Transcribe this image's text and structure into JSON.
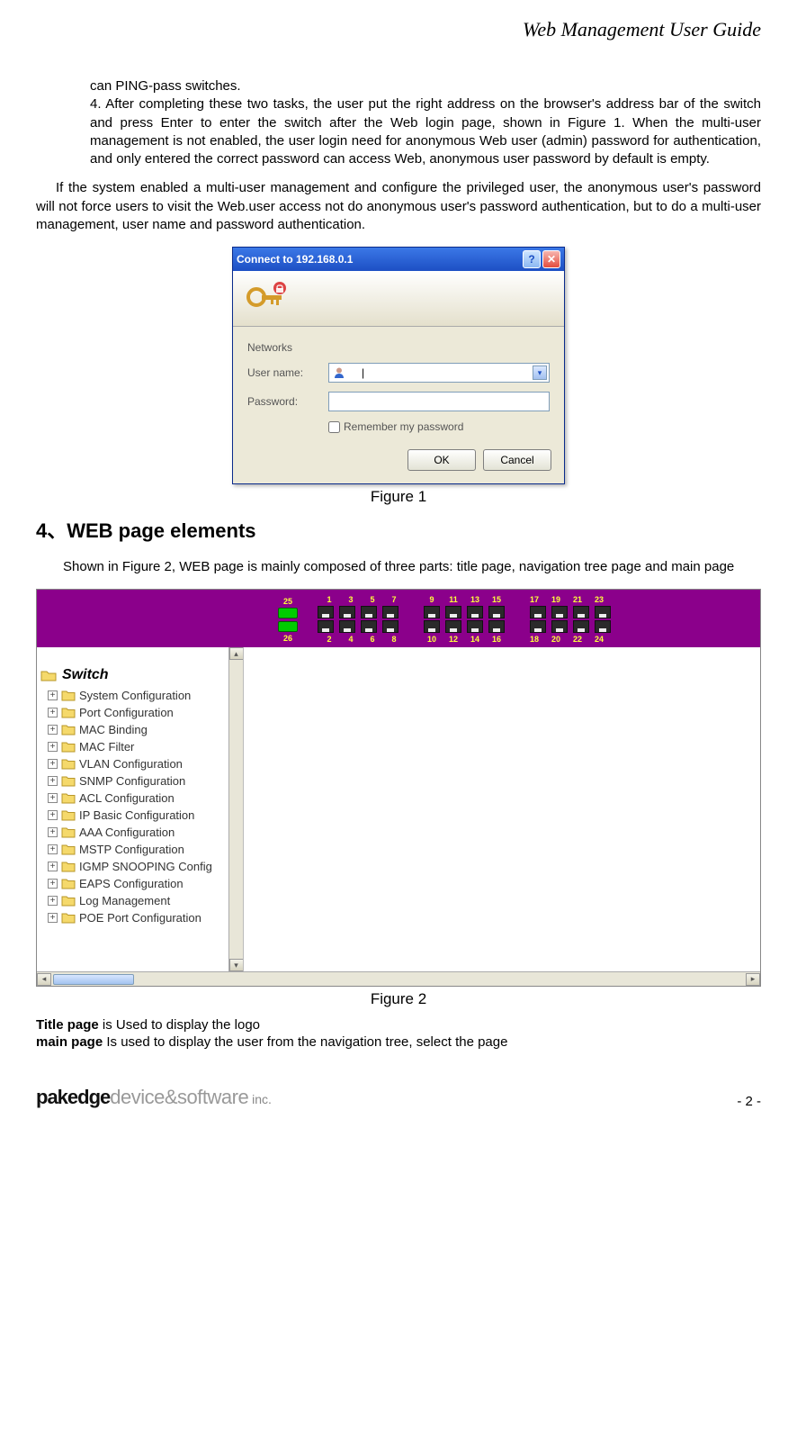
{
  "header": {
    "title": "Web Management User Guide"
  },
  "paragraphs": {
    "p1a": "can PING-pass switches.",
    "p1b": "4. After completing these two tasks, the user put the right address on the browser's address bar of the switch and press Enter to enter the switch after the Web login page, shown in Figure 1. When the multi-user management is not enabled, the user login need for anonymous Web user (admin) password for authentication, and only entered the correct password can access Web, anonymous user password by default is empty.",
    "p2": "If the system enabled a multi-user management and configure the privileged user, the anonymous user's password will not force users to visit the Web.user access not do anonymous user's password authentication, but to do a multi-user management, user name and password authentication."
  },
  "dialog": {
    "title": "Connect to 192.168.0.1",
    "network_label": "Networks",
    "username_label": "User name:",
    "username_value": "",
    "password_label": "Password:",
    "password_value": "",
    "remember": "Remember my password",
    "ok": "OK",
    "cancel": "Cancel"
  },
  "captions": {
    "fig1": "Figure 1",
    "fig2": "Figure 2"
  },
  "section_heading": "4、WEB page elements",
  "section_intro": "Shown in Figure 2, WEB page is mainly composed of three parts: title page, navigation tree page and main page",
  "switch": {
    "top_labels": [
      "25",
      "1",
      "3",
      "5",
      "7",
      "9",
      "11",
      "13",
      "15",
      "17",
      "19",
      "21",
      "23"
    ],
    "bottom_labels": [
      "26",
      "2",
      "4",
      "6",
      "8",
      "10",
      "12",
      "14",
      "16",
      "18",
      "20",
      "22",
      "24"
    ],
    "tree_root": "Switch",
    "items": [
      "System Configuration",
      "Port Configuration",
      "MAC Binding",
      "MAC Filter",
      "VLAN Configuration",
      "SNMP Configuration",
      "ACL Configuration",
      "IP Basic Configuration",
      "AAA Configuration",
      "MSTP Configuration",
      "IGMP SNOOPING Config",
      "EAPS Configuration",
      "Log Management",
      "POE Port Configuration"
    ]
  },
  "definitions": {
    "title_page_b": "Title page",
    "title_page_t": " is Used to display the logo",
    "main_page_b": "main page",
    "main_page_t": " Is used to display the user from the navigation tree, select the page"
  },
  "footer": {
    "logo_brand": "pakedge",
    "logo_rest": "device&software",
    "logo_inc": " inc.",
    "page": "- 2 -"
  }
}
